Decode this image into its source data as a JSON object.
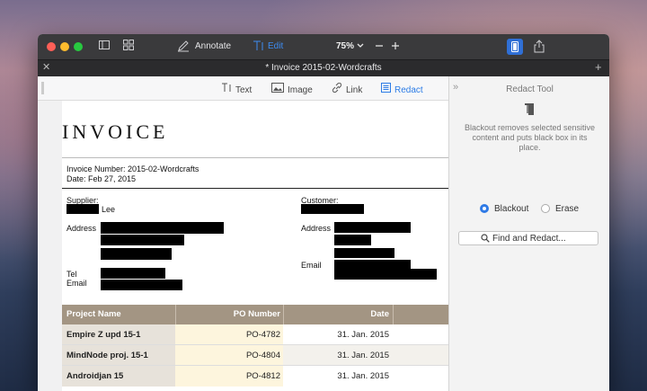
{
  "window": {
    "tab_title": "* Invoice 2015-02-Wordcrafts"
  },
  "toolbar": {
    "annotate_label": "Annotate",
    "edit_label": "Edit",
    "zoom_label": "75%"
  },
  "edit_tools": {
    "text_label": "Text",
    "image_label": "Image",
    "link_label": "Link",
    "redact_label": "Redact"
  },
  "invoice": {
    "title": "INVOICE",
    "number_line": "Invoice Number: 2015-02-Wordcrafts",
    "date_line": "Date:  Feb 27, 2015",
    "supplier_label": "Supplier:",
    "supplier_name_suffix": "Lee",
    "customer_label": "Customer:",
    "address_label": "Address",
    "tel_label": "Tel",
    "email_label": "Email",
    "customer_address_label": "Address",
    "customer_email_label": "Email"
  },
  "table": {
    "headers": [
      "Project Name",
      "PO Number",
      "Date"
    ],
    "rows": [
      {
        "name": "Empire Z upd 15-1",
        "po": "PO-4782",
        "date": "31. Jan. 2015"
      },
      {
        "name": "MindNode proj. 15-1",
        "po": "PO-4804",
        "date": "31. Jan. 2015"
      },
      {
        "name": "Androidjan 15",
        "po": "PO-4812",
        "date": "31. Jan. 2015"
      }
    ]
  },
  "redact_panel": {
    "title": "Redact Tool",
    "description": "Blackout removes selected sensitive content and puts black box in its place.",
    "option_blackout": "Blackout",
    "option_erase": "Erase",
    "selected_option": "Blackout",
    "find_button_label": "Find and Redact..."
  },
  "colors": {
    "accent": "#2f7ae6",
    "table_header": "#a39583",
    "po_column": "#fdf5dd"
  },
  "icons": [
    "sidebar-icon",
    "thumbnails-icon",
    "annotate-pen-icon",
    "text-cursor-icon",
    "chevron-down-icon",
    "minus-icon",
    "plus-icon",
    "sidebar-panel-icon",
    "share-icon",
    "close-icon",
    "image-icon",
    "link-icon",
    "redact-icon",
    "marker-icon",
    "search-icon"
  ]
}
